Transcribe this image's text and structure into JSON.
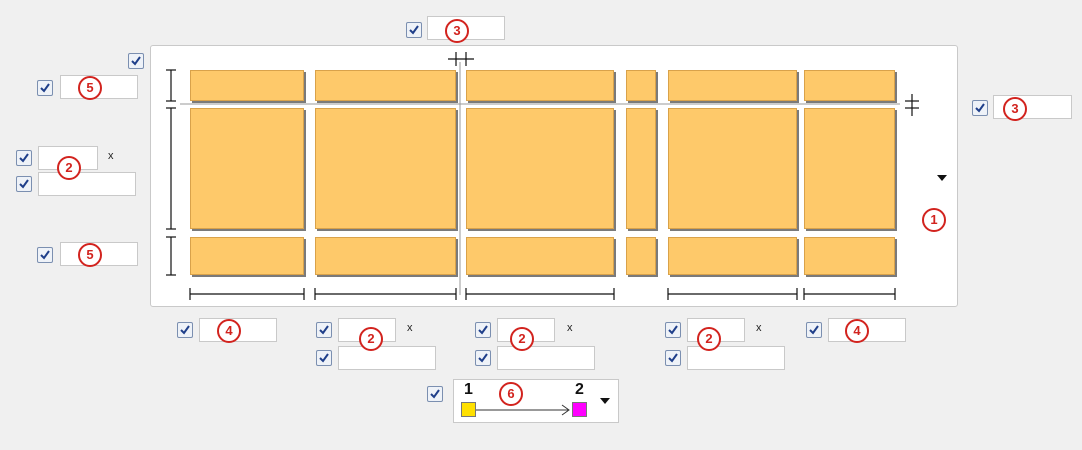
{
  "badges": {
    "b1": "1",
    "b2": "2",
    "b3": "3",
    "b4": "4",
    "b5": "5",
    "b6": "6"
  },
  "x_label": "x",
  "gradient": {
    "start_label": "1",
    "end_label": "2",
    "start_color": "#ffe000",
    "end_color": "#ff00ff"
  },
  "colors": {
    "tile_fill": "#fec96a",
    "badge_red": "#d2231e",
    "checkbox_tick": "#1f3f8a"
  },
  "icons": {
    "checkbox": "checkmark-icon",
    "dropdown": "caret-down-icon",
    "arrow": "arrow-right-icon"
  }
}
